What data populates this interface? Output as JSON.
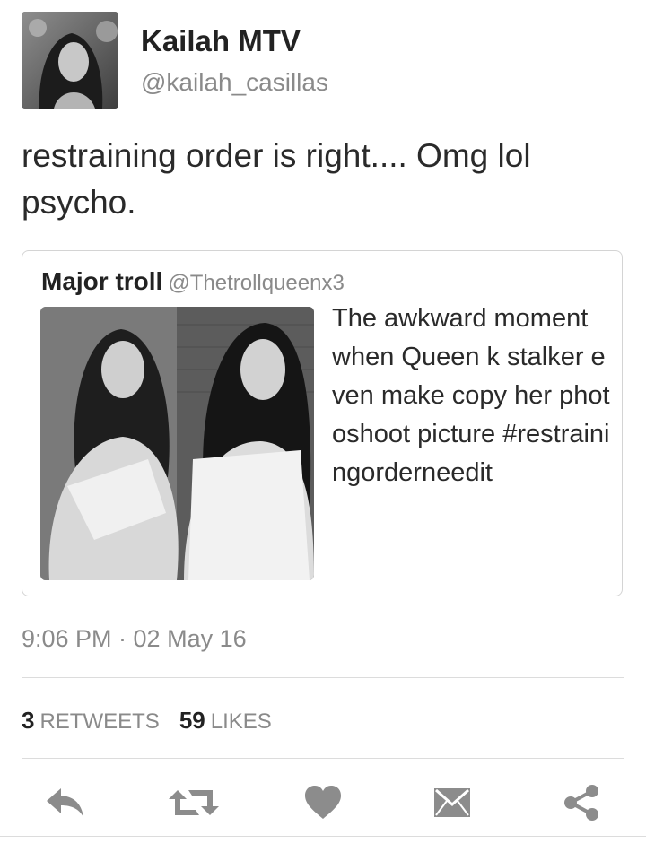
{
  "tweet": {
    "author": {
      "display_name": "Kailah MTV",
      "handle": "@kailah_casillas"
    },
    "text": "restraining order is right.... Omg lol psycho.",
    "quoted": {
      "display_name": "Major troll",
      "handle": "@Thetrollqueenx3",
      "text": "The awkward moment when Queen k stalker even make copy her photoshoot picture #restrainingorderneedit"
    },
    "timestamp": "9:06 PM · 02 May 16",
    "stats": {
      "retweets_count": "3",
      "retweets_label": "RETWEETS",
      "likes_count": "59",
      "likes_label": "LIKES"
    }
  },
  "actions": [
    {
      "name": "reply-icon"
    },
    {
      "name": "retweet-icon"
    },
    {
      "name": "like-icon"
    },
    {
      "name": "message-icon"
    },
    {
      "name": "share-icon"
    }
  ],
  "colors": {
    "text": "#222222",
    "secondary": "#8a8a8a",
    "icon": "#8c8c8c",
    "divider": "#dcdcdc"
  }
}
